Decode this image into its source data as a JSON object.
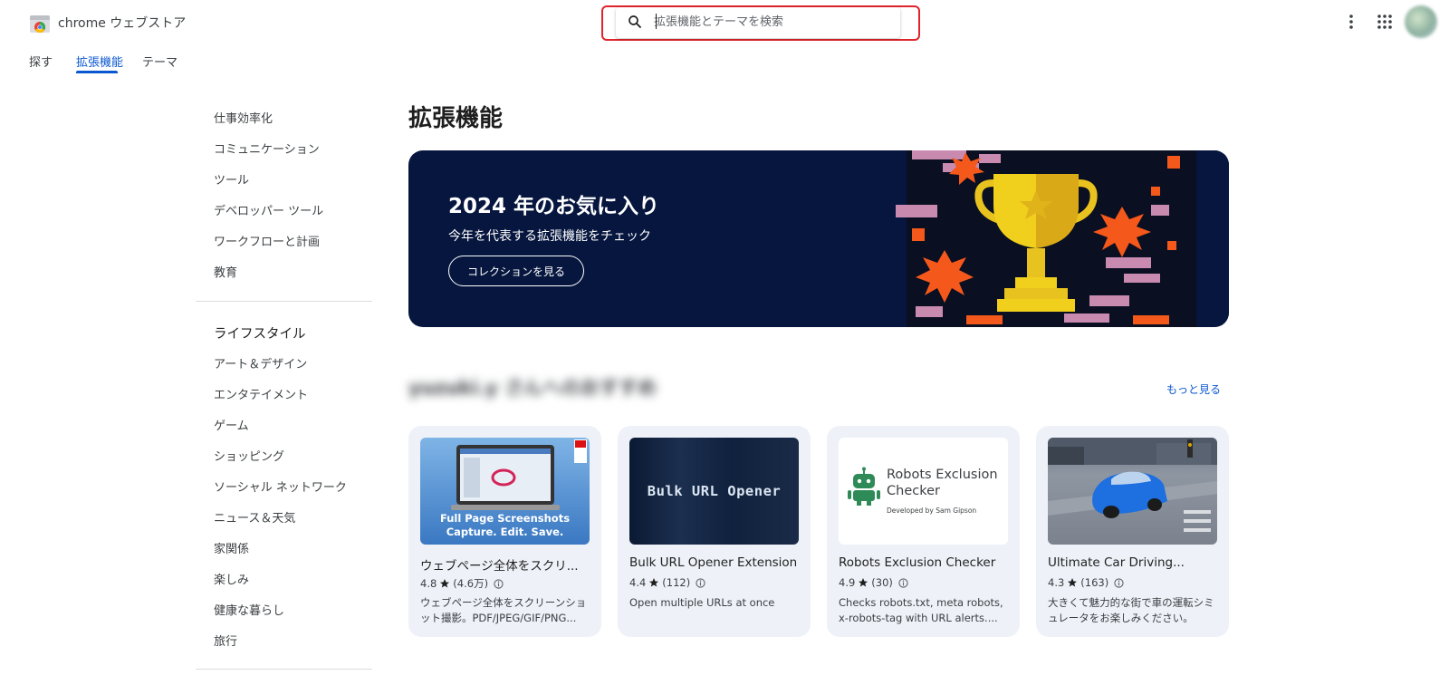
{
  "header": {
    "brand": "chrome ウェブストア",
    "search_placeholder": "拡張機能とテーマを検索"
  },
  "tabs": [
    {
      "label": "探す"
    },
    {
      "label": "拡張機能"
    },
    {
      "label": "テーマ"
    }
  ],
  "sidebar": {
    "group1": [
      "仕事効率化",
      "コミュニケーション",
      "ツール",
      "デベロッパー ツール",
      "ワークフローと計画",
      "教育"
    ],
    "group2_title": "ライフスタイル",
    "group2": [
      "アート＆デザイン",
      "エンタテイメント",
      "ゲーム",
      "ショッピング",
      "ソーシャル ネットワーク",
      "ニュース＆天気",
      "家関係",
      "楽しみ",
      "健康な暮らし",
      "旅行"
    ]
  },
  "main": {
    "title": "拡張機能",
    "banner": {
      "title": "2024 年のお気に入り",
      "subtitle": "今年を代表する拡張機能をチェック",
      "button": "コレクションを見る"
    },
    "recommend_title": "yuzuki.y さんへのおすすめ",
    "more_link": "もっと見る",
    "cards": [
      {
        "name": "ウェブページ全体をスクリ...",
        "rating": "4.8",
        "count": "(4.6万)",
        "description": "ウェブページ全体をスクリーンショット撮影。PDF/JPEG/GIF/PNG...",
        "thumb_line1": "Full Page Screenshots",
        "thumb_line2": "Capture. Edit. Save."
      },
      {
        "name": "Bulk URL Opener Extension",
        "rating": "4.4",
        "count": "(112)",
        "description": "Open multiple URLs at once",
        "thumb_text": "Bulk URL Opener"
      },
      {
        "name": "Robots Exclusion Checker",
        "rating": "4.9",
        "count": "(30)",
        "description": "Checks robots.txt, meta robots, x-robots-tag with URL alerts....",
        "thumb_line1": "Robots Exclusion",
        "thumb_line2": "Checker",
        "thumb_small": "Developed by Sam Gipson"
      },
      {
        "name": "Ultimate Car Driving...",
        "rating": "4.3",
        "count": "(163)",
        "description": "大きくて魅力的な街で車の運転シミュレータをお楽しみください。"
      }
    ]
  },
  "colors": {
    "accent": "#0b57d0",
    "banner_bg": "#06163e",
    "search_highlight": "#e0242b",
    "card_bg": "#eef2f8"
  }
}
